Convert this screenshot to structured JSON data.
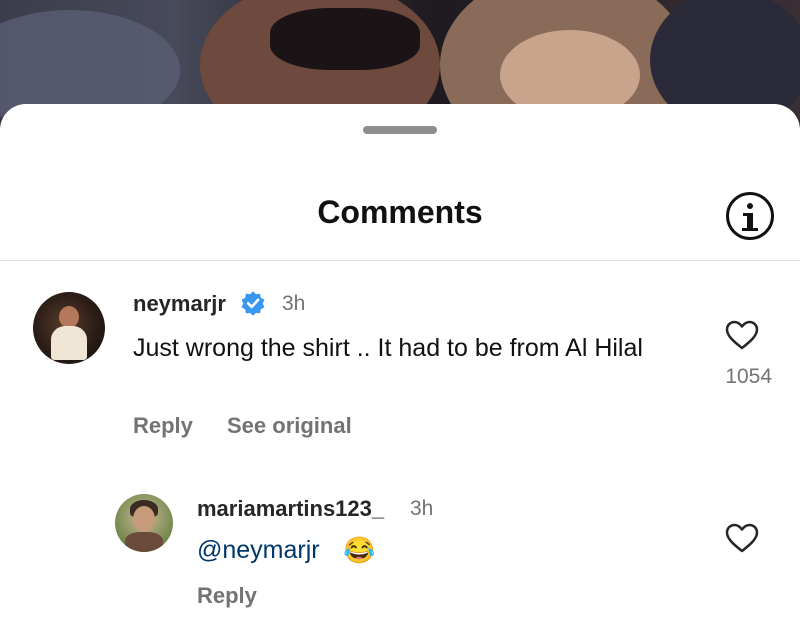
{
  "header": {
    "title": "Comments"
  },
  "comments": [
    {
      "username": "neymarjr",
      "verified": true,
      "time": "3h",
      "text": "Just wrong the shirt .. It had to be from Al Hilal",
      "like_count": "1054",
      "actions": {
        "reply": "Reply",
        "see_original": "See original"
      }
    }
  ],
  "replies": [
    {
      "username": "mariamartins123_",
      "time": "3h",
      "mention": "@neymarjr",
      "emoji": "😂",
      "actions": {
        "reply": "Reply"
      }
    }
  ],
  "colors": {
    "verified_badge": "#3897f0",
    "mention": "#00376b",
    "secondary_text": "#737373"
  },
  "icons": [
    "info-icon",
    "verified-badge-icon",
    "heart-icon",
    "drag-handle"
  ]
}
